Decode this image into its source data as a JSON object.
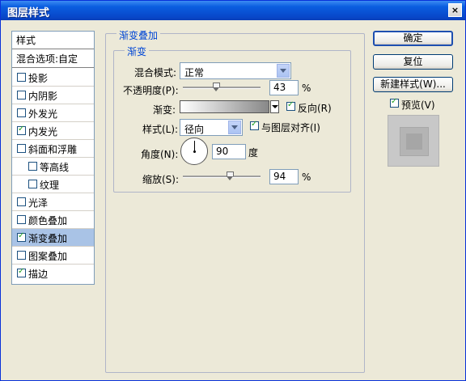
{
  "window": {
    "title": "图层样式",
    "close": "×"
  },
  "styles": {
    "header": "样式",
    "blend_options": "混合选项:自定",
    "items": [
      {
        "label": "投影",
        "checked": false
      },
      {
        "label": "内阴影",
        "checked": false
      },
      {
        "label": "外发光",
        "checked": false
      },
      {
        "label": "内发光",
        "checked": true
      },
      {
        "label": "斜面和浮雕",
        "checked": false
      },
      {
        "label": "等高线",
        "checked": false
      },
      {
        "label": "纹理",
        "checked": false
      },
      {
        "label": "光泽",
        "checked": false
      },
      {
        "label": "颜色叠加",
        "checked": false
      },
      {
        "label": "渐变叠加",
        "checked": true,
        "selected": true
      },
      {
        "label": "图案叠加",
        "checked": false
      },
      {
        "label": "描边",
        "checked": true
      }
    ]
  },
  "panel": {
    "outer_title": "渐变叠加",
    "inner_title": "渐变",
    "blend_mode_label": "混合模式:",
    "blend_mode_value": "正常",
    "opacity_label": "不透明度(P):",
    "opacity_value": "43",
    "opacity_level": 43,
    "percent": "%",
    "gradient_label": "渐变:",
    "reverse_label": "反向(R)",
    "reverse_checked": true,
    "style_label": "样式(L):",
    "style_value": "径向",
    "align_label": "与图层对齐(I)",
    "align_checked": true,
    "angle_label": "角度(N):",
    "angle_value": "90",
    "angle_unit": "度",
    "scale_label": "缩放(S):",
    "scale_value": "94",
    "scale_level": 94
  },
  "buttons": {
    "ok": "确定",
    "reset": "复位",
    "new_style": "新建样式(W)...",
    "preview_label": "预览(V)",
    "preview_checked": true
  }
}
